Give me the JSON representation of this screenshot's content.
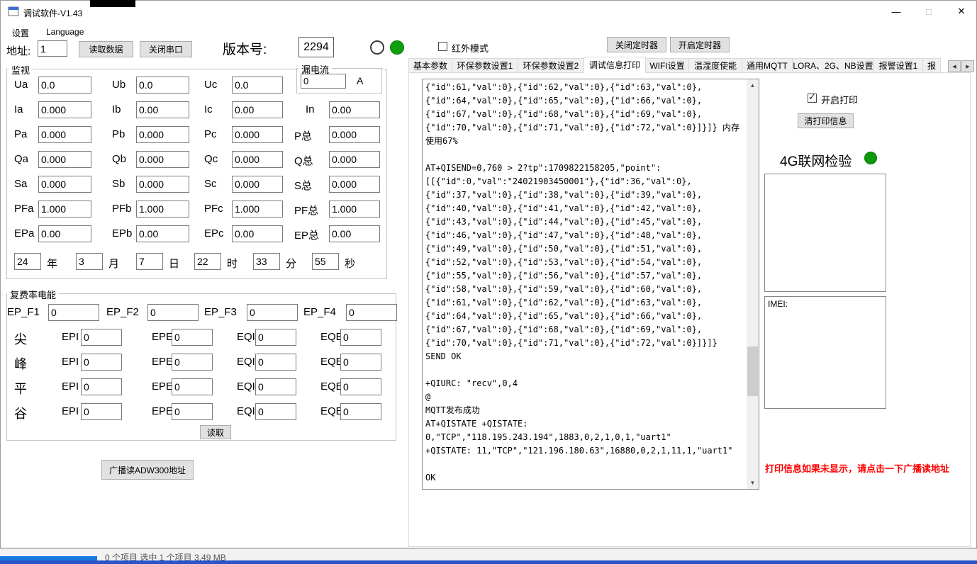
{
  "window": {
    "title": "调试软件-V1.43",
    "status_behind": "0 个项目    选中 1 个项目  3.49 MB"
  },
  "icons": {
    "minimize": "—",
    "maximize": "□",
    "close": "✕",
    "scroll_left": "◀",
    "scroll_right": "▶",
    "scroll_up": "▲",
    "scroll_down": "▼"
  },
  "menu": {
    "items": [
      "设置",
      "Language"
    ]
  },
  "toolbar": {
    "address_label": "地址:",
    "address_value": "1",
    "read_data_button": "读取数据",
    "close_serial_button": "关闭串口",
    "version_label": "版本号:",
    "version_value": "2294",
    "infrared_checkbox_label": "红外模式",
    "close_timer_button": "关闭定时器",
    "open_timer_button": "开启定时器"
  },
  "tabs": {
    "items": [
      "基本参数",
      "环保参数设置1",
      "环保参数设置2",
      "调试信息打印",
      "WIFI设置",
      "温湿度使能",
      "通用MQTT",
      "LORA、2G、NB设置",
      "报警设置1",
      "报"
    ],
    "active": "调试信息打印"
  },
  "monitor": {
    "title": "监视",
    "leakage": {
      "title": "漏电流",
      "value": "0",
      "unit": "A"
    },
    "grid": [
      {
        "cells": [
          {
            "l": "Ua",
            "v": "0.0"
          },
          {
            "l": "Ub",
            "v": "0.0"
          },
          {
            "l": "Uc",
            "v": "0.0"
          }
        ]
      },
      {
        "cells": [
          {
            "l": "Ia",
            "v": "0.000"
          },
          {
            "l": "Ib",
            "v": "0.00"
          },
          {
            "l": "Ic",
            "v": "0.00"
          },
          {
            "l": "In",
            "v": "0.00"
          }
        ]
      },
      {
        "cells": [
          {
            "l": "Pa",
            "v": "0.000"
          },
          {
            "l": "Pb",
            "v": "0.000"
          },
          {
            "l": "Pc",
            "v": "0.000"
          },
          {
            "l": "P总",
            "v": "0.000"
          }
        ]
      },
      {
        "cells": [
          {
            "l": "Qa",
            "v": "0.000"
          },
          {
            "l": "Qb",
            "v": "0.000"
          },
          {
            "l": "Qc",
            "v": "0.000"
          },
          {
            "l": "Q总",
            "v": "0.000"
          }
        ]
      },
      {
        "cells": [
          {
            "l": "Sa",
            "v": "0.000"
          },
          {
            "l": "Sb",
            "v": "0.000"
          },
          {
            "l": "Sc",
            "v": "0.000"
          },
          {
            "l": "S总",
            "v": "0.000"
          }
        ]
      },
      {
        "cells": [
          {
            "l": "PFa",
            "v": "1.000"
          },
          {
            "l": "PFb",
            "v": "1.000"
          },
          {
            "l": "PFc",
            "v": "1.000"
          },
          {
            "l": "PF总",
            "v": "1.000"
          }
        ]
      },
      {
        "cells": [
          {
            "l": "EPa",
            "v": "0.00"
          },
          {
            "l": "EPb",
            "v": "0.00"
          },
          {
            "l": "EPc",
            "v": "0.00"
          },
          {
            "l": "EP总",
            "v": "0.00"
          }
        ]
      }
    ],
    "datetime": [
      {
        "v": "24",
        "u": "年"
      },
      {
        "v": "3",
        "u": "月"
      },
      {
        "v": "7",
        "u": "日"
      },
      {
        "v": "22",
        "u": "时"
      },
      {
        "v": "33",
        "u": "分"
      },
      {
        "v": "55",
        "u": "秒"
      }
    ]
  },
  "tariff": {
    "title": "复费率电能",
    "totals": [
      {
        "l": "EP_F1",
        "v": "0"
      },
      {
        "l": "EP_F2",
        "v": "0"
      },
      {
        "l": "EP_F3",
        "v": "0"
      },
      {
        "l": "EP_F4",
        "v": "0"
      }
    ],
    "col_labels": {
      "epi": "EPI",
      "epe": "EPE",
      "eqi": "EQI",
      "eqe": "EQE"
    },
    "rows": [
      {
        "name": "尖",
        "epi": "0",
        "epe": "0",
        "eqi": "0",
        "eqe": "0"
      },
      {
        "name": "峰",
        "epi": "0",
        "epe": "0",
        "eqi": "0",
        "eqe": "0"
      },
      {
        "name": "平",
        "epi": "0",
        "epe": "0",
        "eqi": "0",
        "eqe": "0"
      },
      {
        "name": "谷",
        "epi": "0",
        "epe": "0",
        "eqi": "0",
        "eqe": "0"
      }
    ],
    "read_button": "读取"
  },
  "broadcast_button": "广播读ADW300地址",
  "debug": {
    "text": "{\"id\":61,\"val\":0},{\"id\":62,\"val\":0},{\"id\":63,\"val\":0},\n{\"id\":64,\"val\":0},{\"id\":65,\"val\":0},{\"id\":66,\"val\":0},\n{\"id\":67,\"val\":0},{\"id\":68,\"val\":0},{\"id\":69,\"val\":0},\n{\"id\":70,\"val\":0},{\"id\":71,\"val\":0},{\"id\":72,\"val\":0}]}]} 内存使用67%\n\nAT+QISEND=0,760 > 2?tp\":1709822158205,\"point\":\n[[{\"id\":0,\"val\":\"24021903450001\"},{\"id\":36,\"val\":0},\n{\"id\":37,\"val\":0},{\"id\":38,\"val\":0},{\"id\":39,\"val\":0},\n{\"id\":40,\"val\":0},{\"id\":41,\"val\":0},{\"id\":42,\"val\":0},\n{\"id\":43,\"val\":0},{\"id\":44,\"val\":0},{\"id\":45,\"val\":0},\n{\"id\":46,\"val\":0},{\"id\":47,\"val\":0},{\"id\":48,\"val\":0},\n{\"id\":49,\"val\":0},{\"id\":50,\"val\":0},{\"id\":51,\"val\":0},\n{\"id\":52,\"val\":0},{\"id\":53,\"val\":0},{\"id\":54,\"val\":0},\n{\"id\":55,\"val\":0},{\"id\":56,\"val\":0},{\"id\":57,\"val\":0},\n{\"id\":58,\"val\":0},{\"id\":59,\"val\":0},{\"id\":60,\"val\":0},\n{\"id\":61,\"val\":0},{\"id\":62,\"val\":0},{\"id\":63,\"val\":0},\n{\"id\":64,\"val\":0},{\"id\":65,\"val\":0},{\"id\":66,\"val\":0},\n{\"id\":67,\"val\":0},{\"id\":68,\"val\":0},{\"id\":69,\"val\":0},\n{\"id\":70,\"val\":0},{\"id\":71,\"val\":0},{\"id\":72,\"val\":0}]}]}\nSEND OK\n\n+QIURC: \"recv\",0,4\n@\nMQTT发布成功\nAT+QISTATE +QISTATE:\n0,\"TCP\",\"118.195.243.194\",1883,0,2,1,0,1,\"uart1\"\n+QISTATE: 11,\"TCP\",\"121.196.180.63\",16880,0,2,1,11,1,\"uart1\"\n\nOK"
  },
  "right_panel": {
    "print_checkbox": "开启打印",
    "clear_print_button": "清打印信息",
    "network_label": "4G联网检验",
    "imei_label": "IMEI:",
    "warning_text": "打印信息如果未显示，请点击一下广播读地址"
  }
}
